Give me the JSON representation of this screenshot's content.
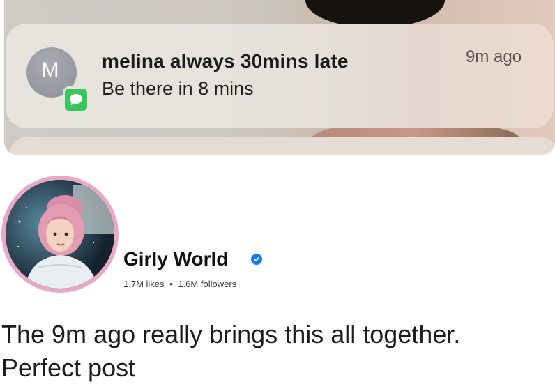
{
  "notification": {
    "avatar_initial": "M",
    "sender": "melina always 30mins late",
    "message": "Be there in 8 mins",
    "time": "9m ago",
    "app_badge_icon": "messages-bubble-icon",
    "badge_color": "#38c75a"
  },
  "page": {
    "name": "Girly World",
    "verified_icon": "verified-check-icon",
    "verified_color": "#1877f2",
    "likes": "1.7M likes",
    "separator": "•",
    "followers": "1.6M followers"
  },
  "post": {
    "line1": "The 9m ago really brings this all together.",
    "line2": "Perfect post"
  }
}
